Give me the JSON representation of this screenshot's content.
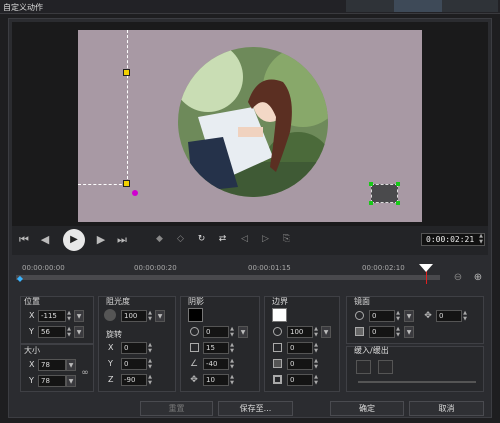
{
  "window": {
    "title": "自定义动作"
  },
  "controls": {
    "timecode": "0:00:02:21"
  },
  "timeline": {
    "ticks": [
      "00:00:00:00",
      "00:00:00:20",
      "00:00:01:15",
      "00:00:02:10"
    ],
    "position_seconds": 2.7
  },
  "position": {
    "title": "位置",
    "x_label": "X",
    "y_label": "Y",
    "x": "-115",
    "y": "56"
  },
  "size": {
    "title": "大小",
    "x_label": "X",
    "y_label": "Y",
    "x": "78",
    "y": "78"
  },
  "opacity": {
    "title": "阻光度",
    "value": "100"
  },
  "rotation": {
    "title": "旋转",
    "x_label": "X",
    "y_label": "Y",
    "z_label": "Z",
    "x": "0",
    "y": "0",
    "z": "-90"
  },
  "shadow": {
    "title": "阴影",
    "opacity": "0",
    "blur": "15",
    "angle": "-40",
    "distance": "10",
    "color": "#000000"
  },
  "border": {
    "title": "边界",
    "opacity": "100",
    "v1": "0",
    "v2": "0",
    "v3": "0",
    "color": "#ffffff"
  },
  "mirror": {
    "title": "镜面",
    "opacity": "0",
    "v2": "0",
    "v3": "0"
  },
  "fade": {
    "title": "缓入/缓出"
  },
  "buttons": {
    "reset": "重置",
    "save_as": "保存至...",
    "ok": "确定",
    "cancel": "取消"
  }
}
